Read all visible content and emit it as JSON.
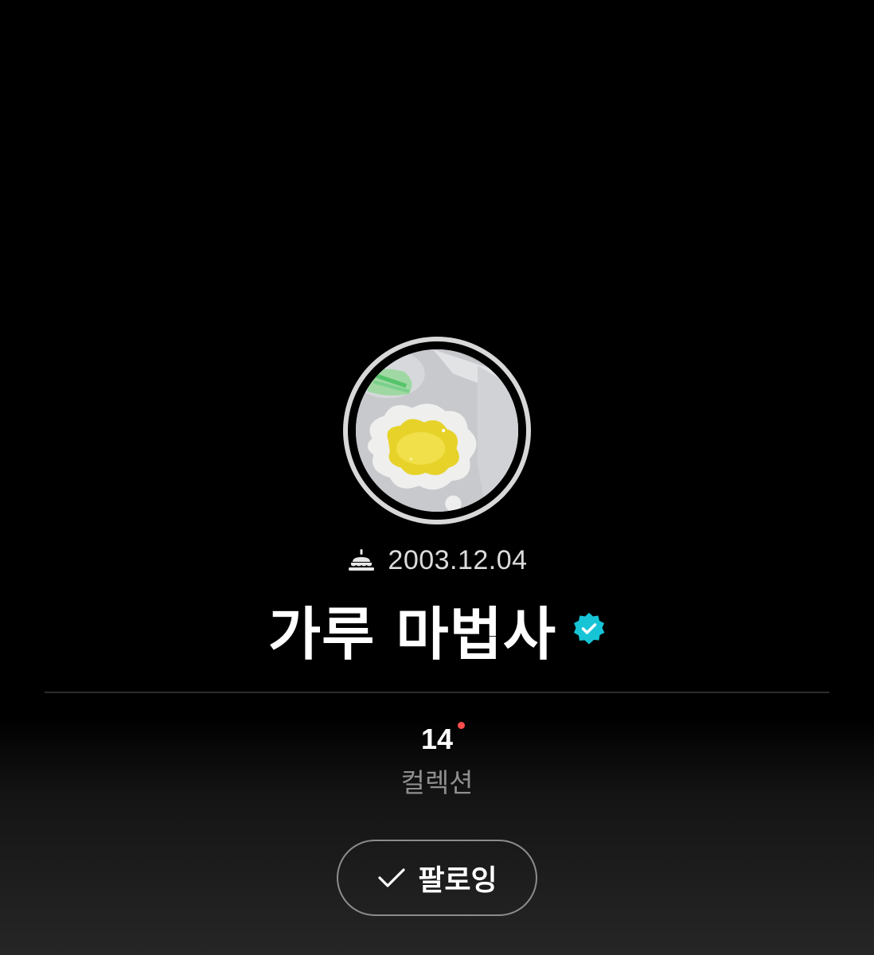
{
  "profile": {
    "birthday": "2003.12.04",
    "name": "가루 마법사",
    "verified": true,
    "stats": {
      "collection_count": "14",
      "collection_label": "컬렉션",
      "has_new_indicator": true
    },
    "follow_button": {
      "label": "팔로잉",
      "state": "following"
    }
  },
  "icons": {
    "birthday": "cake-icon",
    "verified": "verified-badge-icon",
    "follow": "check-icon"
  },
  "colors": {
    "background_top": "#000000",
    "background_bottom": "#262626",
    "verified_badge": "#16c4d6",
    "new_dot": "#ff4d4d",
    "secondary_text": "#8f8f8f"
  }
}
